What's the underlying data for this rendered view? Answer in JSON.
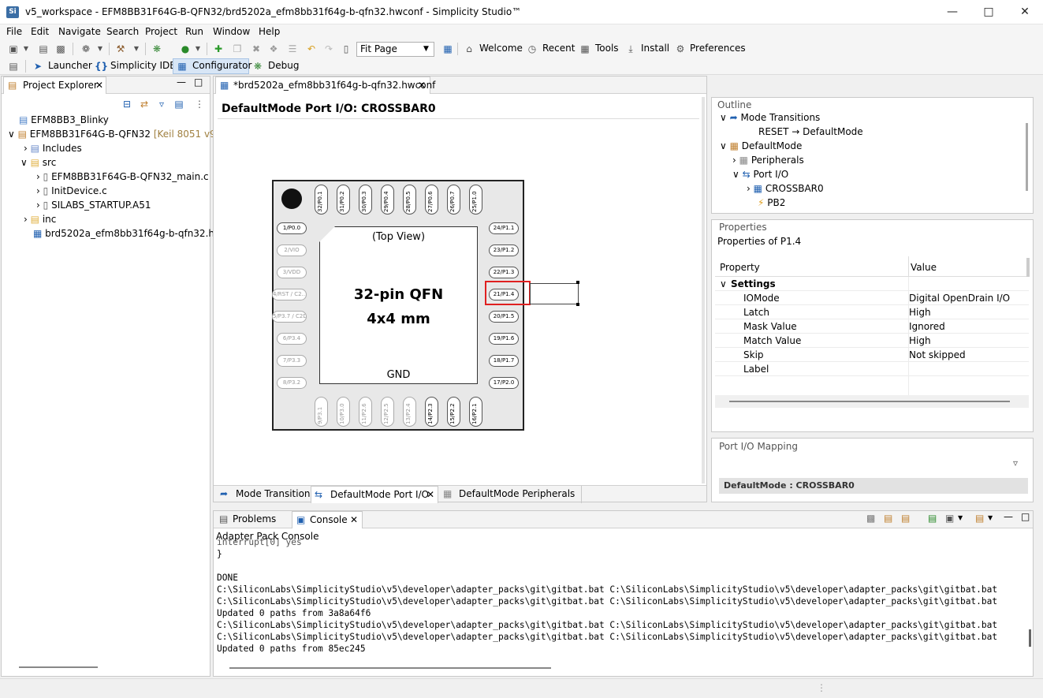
{
  "window": {
    "title": "v5_workspace - EFM8BB31F64G-B-QFN32/brd5202a_efm8bb31f64g-b-qfn32.hwconf - Simplicity Studio™",
    "app_icon": "Si"
  },
  "menu": [
    "File",
    "Edit",
    "Navigate",
    "Search",
    "Project",
    "Run",
    "Window",
    "Help"
  ],
  "toolbar": {
    "zoom_value": "Fit Page",
    "welcome": "Welcome",
    "recent": "Recent",
    "tools": "Tools",
    "install": "Install",
    "preferences": "Preferences"
  },
  "perspectives": {
    "launcher": "Launcher",
    "ide": "Simplicity IDE",
    "configurator": "Configurator",
    "debug": "Debug"
  },
  "project_explorer": {
    "tab": "Project Explorer",
    "items": [
      {
        "label": "EFM8BB3_Blinky",
        "icon": "folder-icon"
      },
      {
        "label": "EFM8BB31F64G-B-QFN32",
        "suffix": "[Keil 8051 v9.60",
        "icon": "project-icon"
      },
      {
        "label": "Includes",
        "icon": "includes-icon"
      },
      {
        "label": "src",
        "icon": "folder-icon"
      },
      {
        "label": "EFM8BB31F64G-B-QFN32_main.c",
        "icon": "c-file-icon"
      },
      {
        "label": "InitDevice.c",
        "icon": "c-file-icon"
      },
      {
        "label": "SILABS_STARTUP.A51",
        "icon": "asm-file-icon"
      },
      {
        "label": "inc",
        "icon": "folder-icon"
      },
      {
        "label": "brd5202a_efm8bb31f64g-b-qfn32.hwc",
        "icon": "hwconf-file-icon"
      }
    ]
  },
  "editor": {
    "tab": "*brd5202a_efm8bb31f64g-b-qfn32.hwconf",
    "header": "DefaultMode Port I/O: CROSSBAR0",
    "chip": {
      "top_view": "(Top View)",
      "name": "32-pin QFN",
      "size": "4x4 mm",
      "gnd": "GND"
    },
    "top_pins": [
      "32/P0.1",
      "31/P0.2",
      "30/P0.3",
      "29/P0.4",
      "28/P0.5",
      "27/P0.6",
      "26/P0.7",
      "25/P1.0"
    ],
    "left_pins": [
      "1/P0.0",
      "2/VIO",
      "3/VDD",
      "4/RST / C2...",
      "5/P3.7 / C2D",
      "6/P3.4",
      "7/P3.3",
      "8/P3.2"
    ],
    "right_pins": [
      "24/P1.1",
      "23/P1.2",
      "22/P1.3",
      "21/P1.4",
      "20/P1.5",
      "19/P1.6",
      "18/P1.7",
      "17/P2.0"
    ],
    "bottom_pins": [
      "9/P3.1",
      "10/P3.0",
      "11/P2.6",
      "12/P2.5",
      "13/P2.4",
      "14/P2.3",
      "15/P2.2",
      "16/P2.1"
    ],
    "bottom_tabs": [
      "Mode Transitions",
      "DefaultMode Port I/O",
      "DefaultMode Peripherals"
    ]
  },
  "outline": {
    "title": "Outline",
    "items": [
      "Mode Transitions",
      "RESET → DefaultMode",
      "DefaultMode",
      "Peripherals",
      "Port I/O",
      "CROSSBAR0",
      "PB2"
    ]
  },
  "properties": {
    "title": "Properties",
    "subtitle": "Properties of P1.4",
    "col_property": "Property",
    "col_value": "Value",
    "group": "Settings",
    "rows": [
      {
        "name": "IOMode",
        "value": "Digital OpenDrain I/O"
      },
      {
        "name": "Latch",
        "value": "High"
      },
      {
        "name": "Mask Value",
        "value": "Ignored"
      },
      {
        "name": "Match Value",
        "value": "High"
      },
      {
        "name": "Skip",
        "value": "Not skipped"
      },
      {
        "name": "Label",
        "value": ""
      }
    ]
  },
  "port_io_mapping": {
    "title": "Port I/O Mapping",
    "row": "DefaultMode : CROSSBAR0"
  },
  "console": {
    "tabs": [
      "Problems",
      "Console"
    ],
    "title": "Adapter Pack Console",
    "lines": [
      "  interrupt[0] yes",
      "}",
      "",
      "DONE",
      "C:\\SiliconLabs\\SimplicityStudio\\v5\\developer\\adapter_packs\\git\\gitbat.bat C:\\SiliconLabs\\SimplicityStudio\\v5\\developer\\adapter_packs\\git\\gitbat.bat",
      "C:\\SiliconLabs\\SimplicityStudio\\v5\\developer\\adapter_packs\\git\\gitbat.bat C:\\SiliconLabs\\SimplicityStudio\\v5\\developer\\adapter_packs\\git\\gitbat.bat",
      "Updated 0 paths from 3a8a64f6",
      "C:\\SiliconLabs\\SimplicityStudio\\v5\\developer\\adapter_packs\\git\\gitbat.bat C:\\SiliconLabs\\SimplicityStudio\\v5\\developer\\adapter_packs\\git\\gitbat.bat",
      "C:\\SiliconLabs\\SimplicityStudio\\v5\\developer\\adapter_packs\\git\\gitbat.bat C:\\SiliconLabs\\SimplicityStudio\\v5\\developer\\adapter_packs\\git\\gitbat.bat",
      "Updated 0 paths from 85ec245"
    ]
  },
  "colors": {
    "accent": "#1f6ec6",
    "highlight": "#e02020",
    "folder": "#e8c060"
  }
}
